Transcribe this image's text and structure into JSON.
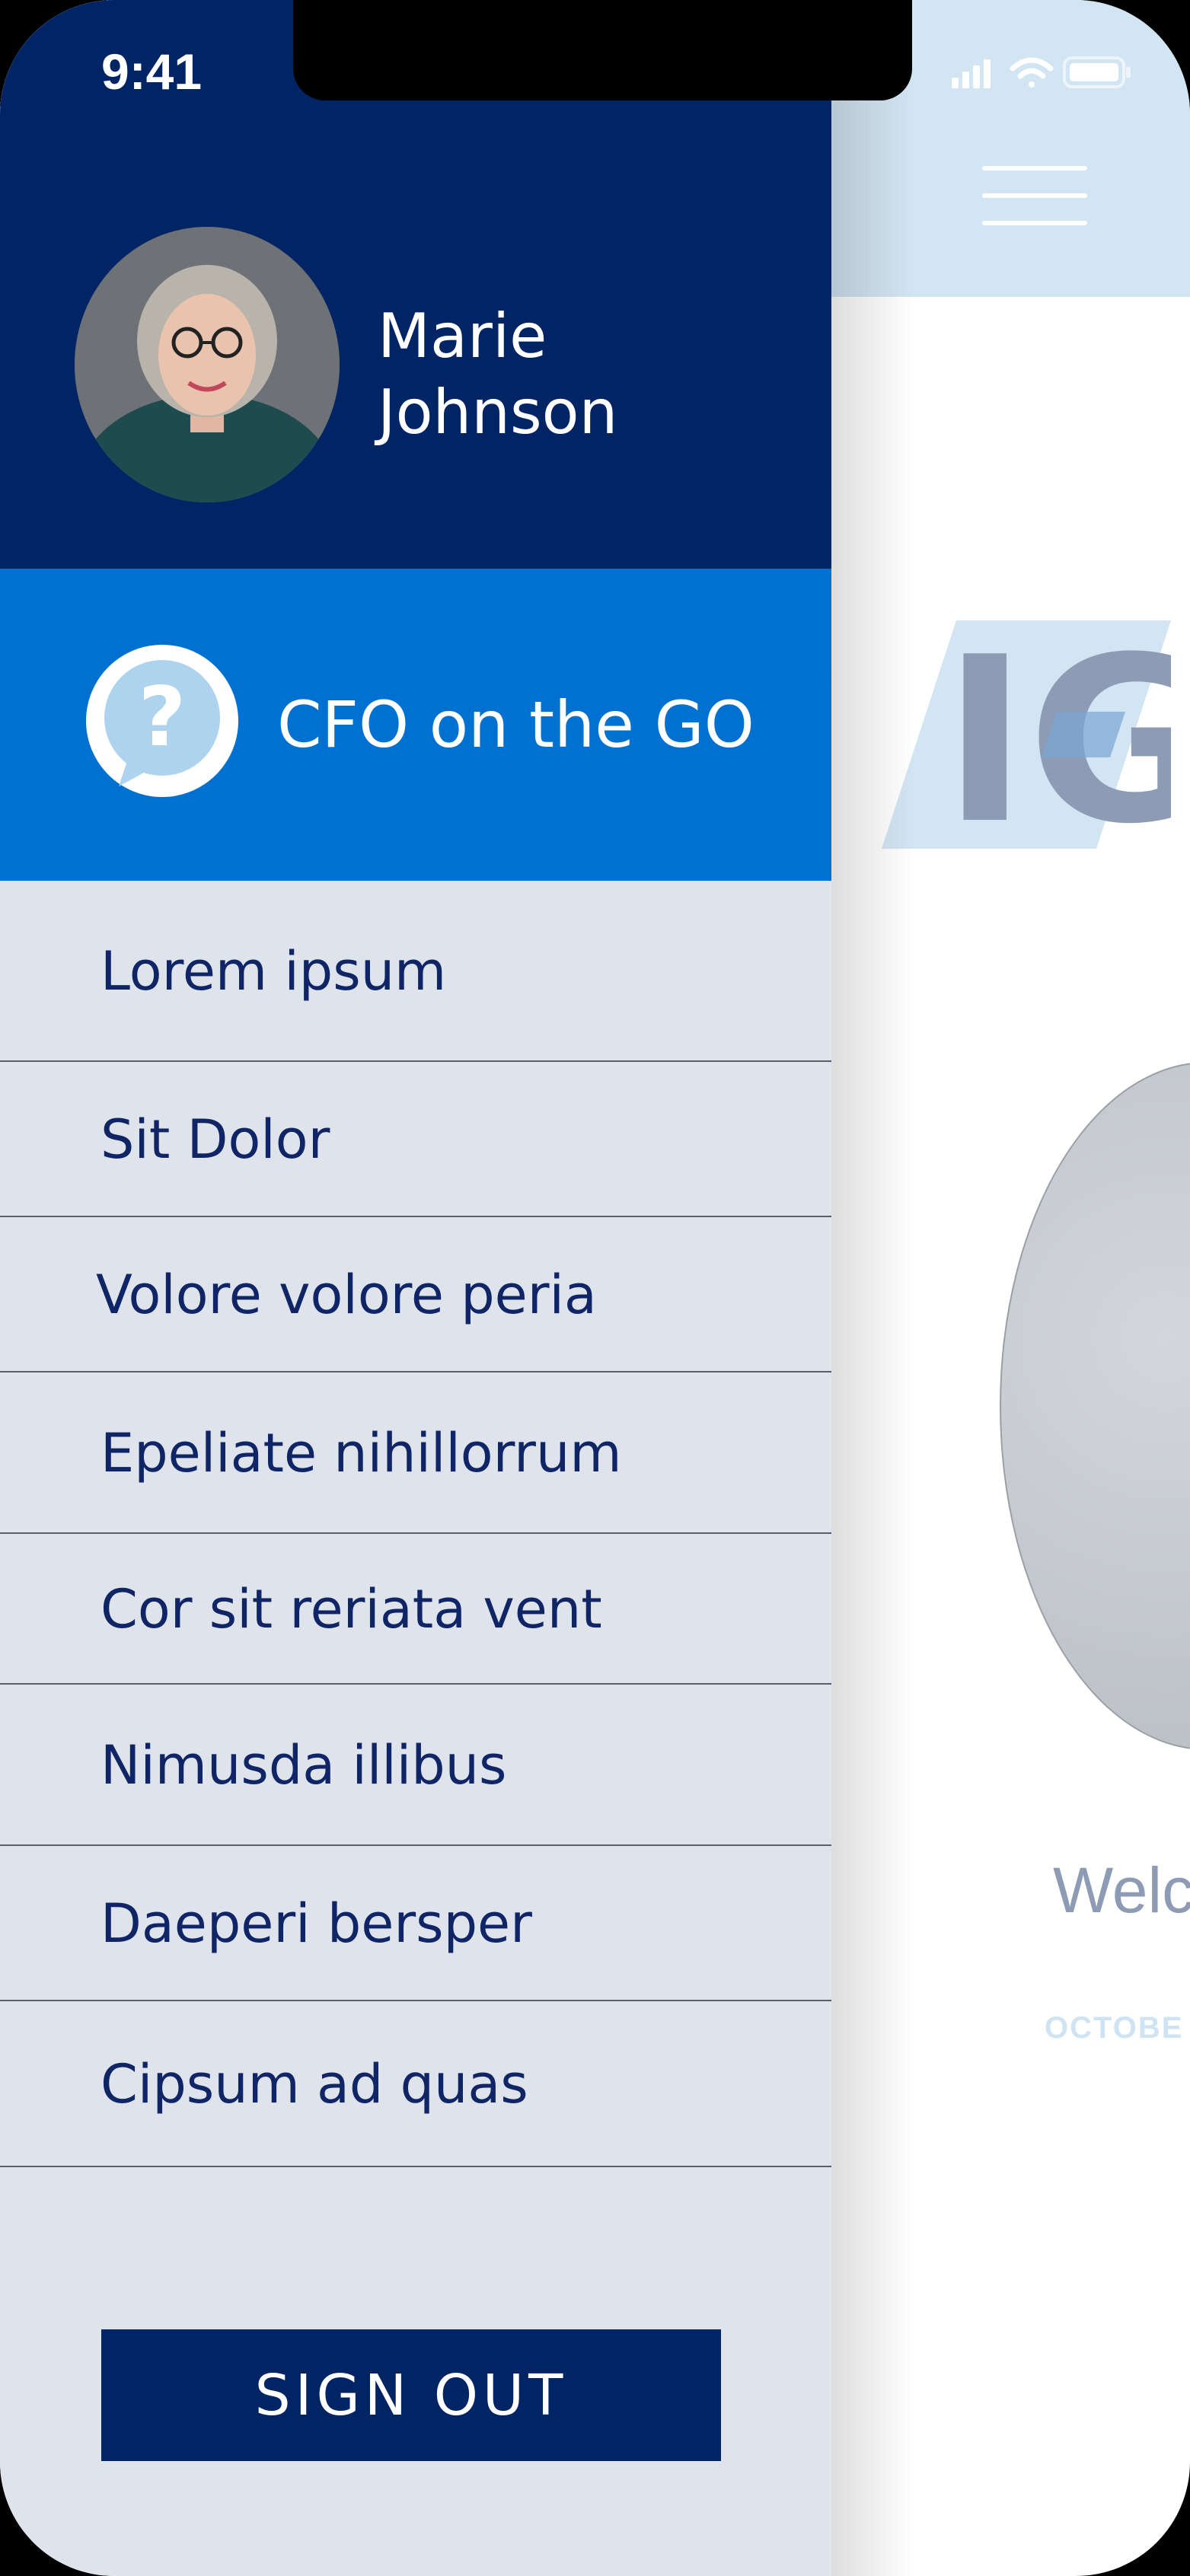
{
  "status_bar": {
    "time": "9:41",
    "icons": [
      "signal-icon",
      "wifi-icon",
      "battery-icon"
    ]
  },
  "drawer": {
    "user": {
      "first_name": "Marie",
      "last_name": "Johnson"
    },
    "feature": {
      "label": "CFO on the GO",
      "icon": "help-chat-icon"
    },
    "menu_items": [
      {
        "label": "Lorem ipsum"
      },
      {
        "label": "Sit Dolor"
      },
      {
        "label": "Volore volore peria"
      },
      {
        "label": "Epeliate nihillorrum"
      },
      {
        "label": "Cor sit reriata vent"
      },
      {
        "label": "Nimusda illibus"
      },
      {
        "label": "Daeperi bersper"
      },
      {
        "label": "Cipsum ad quas"
      }
    ],
    "sign_out_label": "SIGN OUT"
  },
  "background_app": {
    "logo_text": "IG",
    "welcome_text": "Welc",
    "date_text": "OCTOBE"
  },
  "colors": {
    "navy": "#002464",
    "blue": "#0171d1",
    "drawer_bg": "#dfe3eb",
    "menu_text": "#0f2566",
    "header_light": "#d2e5f2"
  }
}
